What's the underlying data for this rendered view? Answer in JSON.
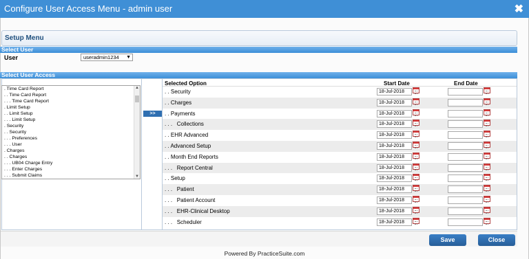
{
  "window": {
    "title": "Configure User Access Menu - admin user",
    "close_glyph": "✖"
  },
  "setup": {
    "label": "Setup Menu"
  },
  "select_user": {
    "section": "Select User",
    "label": "User",
    "value": "useradmin1234"
  },
  "select_access": {
    "section": "Select User Access",
    "move_label": ">>"
  },
  "tree": [
    ". Time Card Report",
    ". . Time Card Report",
    ". . . Time Card Report",
    ". Limit Setup",
    ". . Limit Setup",
    ". . . Limit Setup",
    ". Security",
    ". . Security",
    ". . . Preferences",
    ". . . User",
    ". Charges",
    ". . Charges",
    ". . . UB04 Charge Entry",
    ". . . Enter Charges",
    ". . . Submit Claims"
  ],
  "grid": {
    "headers": {
      "option": "Selected Option",
      "start": "Start Date",
      "end": "End Date"
    },
    "rows": [
      {
        "option": ". . Security",
        "start": "18-Jul-2018"
      },
      {
        "option": ". . Charges",
        "start": "18-Jul-2018"
      },
      {
        "option": ". . Payments",
        "start": "18-Jul-2018"
      },
      {
        "option": ". . .   Collections",
        "start": "18-Jul-2018"
      },
      {
        "option": ". . EHR Advanced",
        "start": "18-Jul-2018"
      },
      {
        "option": ". . Advanced Setup",
        "start": "18-Jul-2018"
      },
      {
        "option": ". . Month End Reports",
        "start": "18-Jul-2018"
      },
      {
        "option": ". . .   Report Central",
        "start": "18-Jul-2018"
      },
      {
        "option": ". . Setup",
        "start": "18-Jul-2018"
      },
      {
        "option": ". . .   Patient",
        "start": "18-Jul-2018"
      },
      {
        "option": ". . .   Patient Account",
        "start": "18-Jul-2018"
      },
      {
        "option": ". . .   EHR-Clinical Desktop",
        "start": "18-Jul-2018"
      },
      {
        "option": ". . .   Scheduler",
        "start": "18-Jul-2018"
      }
    ]
  },
  "buttons": {
    "save": "Save",
    "close": "Close"
  },
  "footer": {
    "powered": "Powered By PracticeSuite.com"
  },
  "colors": {
    "titlebar": "#3f8fd6",
    "section": "#3c8fd8",
    "button": "#2f6fb1"
  }
}
